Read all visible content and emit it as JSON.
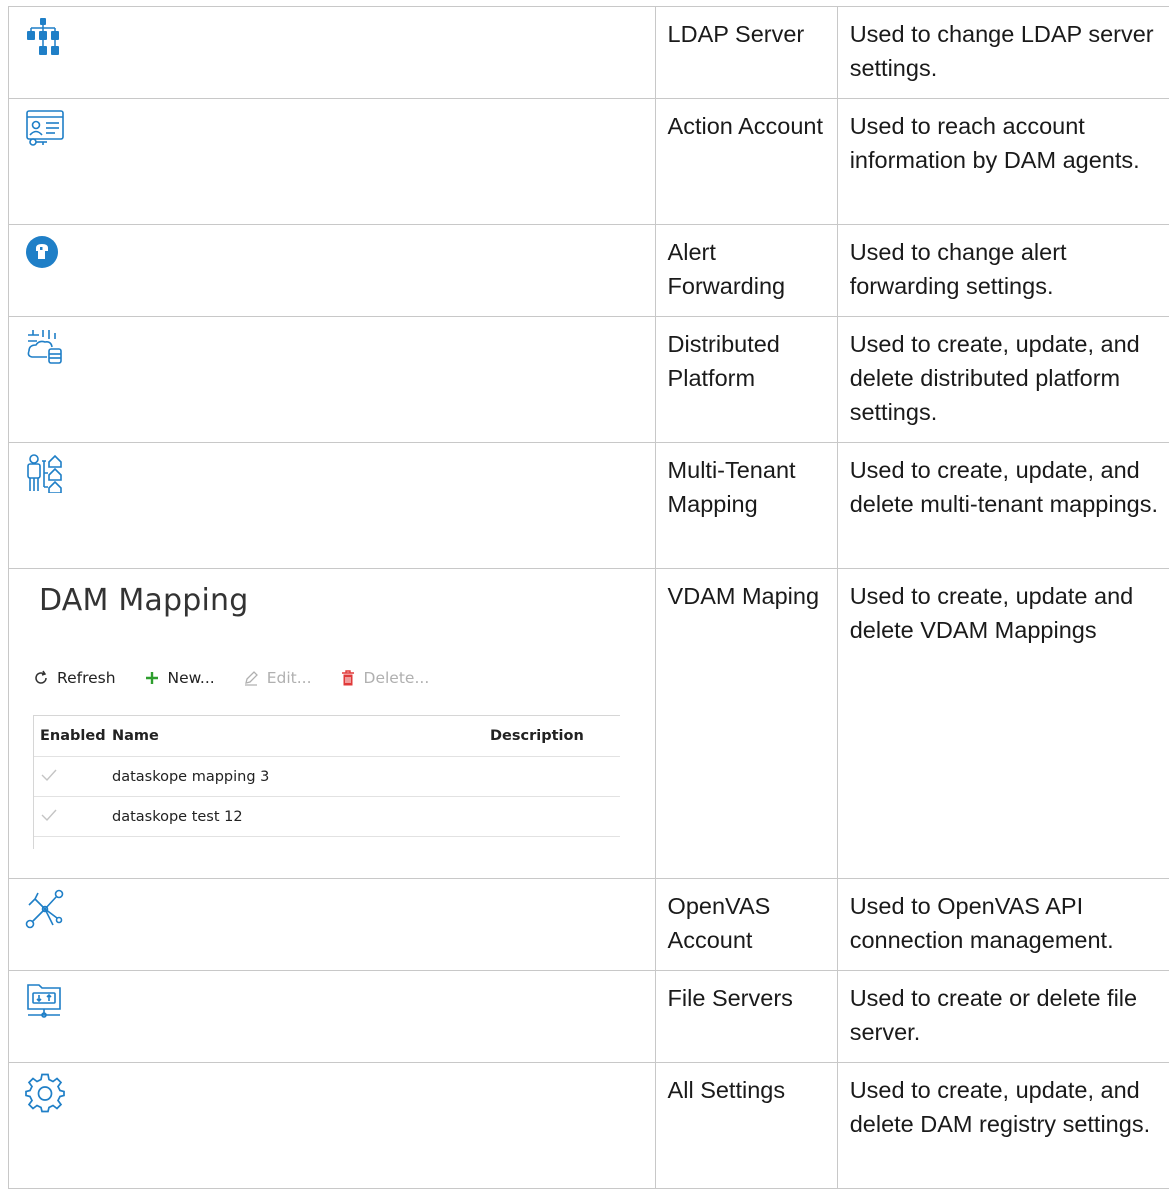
{
  "colors": {
    "icon_blue": "#1f7fc7",
    "border": "#c8c8c8",
    "new_green": "#2e9e2e",
    "delete_red": "#e03a3a"
  },
  "rows": [
    {
      "icon": "ldap-hierarchy-icon",
      "name": "LDAP Server",
      "description": "Used to change LDAP server settings."
    },
    {
      "icon": "account-key-icon",
      "name": "Action Account",
      "description": "Used to reach account information by DAM agents."
    },
    {
      "icon": "alert-forwarding-icon",
      "name": "Alert Forwarding",
      "description": "Used to change alert forwarding settings."
    },
    {
      "icon": "distributed-platform-icon",
      "name": "Distributed Platform",
      "description": "Used to create, update, and delete distributed platform settings."
    },
    {
      "icon": "multi-tenant-icon",
      "name": "Multi-Tenant Mapping",
      "description": "Used to create, update, and delete multi-tenant mappings."
    },
    {
      "icon": "dam-mapping-screenshot",
      "name": "VDAM Maping",
      "description": "Used to create, update and delete VDAM Mappings"
    },
    {
      "icon": "network-nodes-icon",
      "name": "OpenVAS Account",
      "description": "Used to OpenVAS API connection management."
    },
    {
      "icon": "file-server-icon",
      "name": "File Servers",
      "description": "Used to create or delete file server."
    },
    {
      "icon": "gear-icon",
      "name": "All Settings",
      "description": "Used to create, update, and delete DAM registry settings."
    }
  ],
  "dam_mapping": {
    "title": "DAM Mapping",
    "toolbar": {
      "refresh": "Refresh",
      "new": "New...",
      "edit": "Edit...",
      "delete": "Delete..."
    },
    "columns": {
      "enabled": "Enabled",
      "name": "Name",
      "description": "Description"
    },
    "items": [
      {
        "enabled": true,
        "name": "dataskope mapping 3",
        "description": ""
      },
      {
        "enabled": true,
        "name": "dataskope test 12",
        "description": ""
      }
    ]
  }
}
